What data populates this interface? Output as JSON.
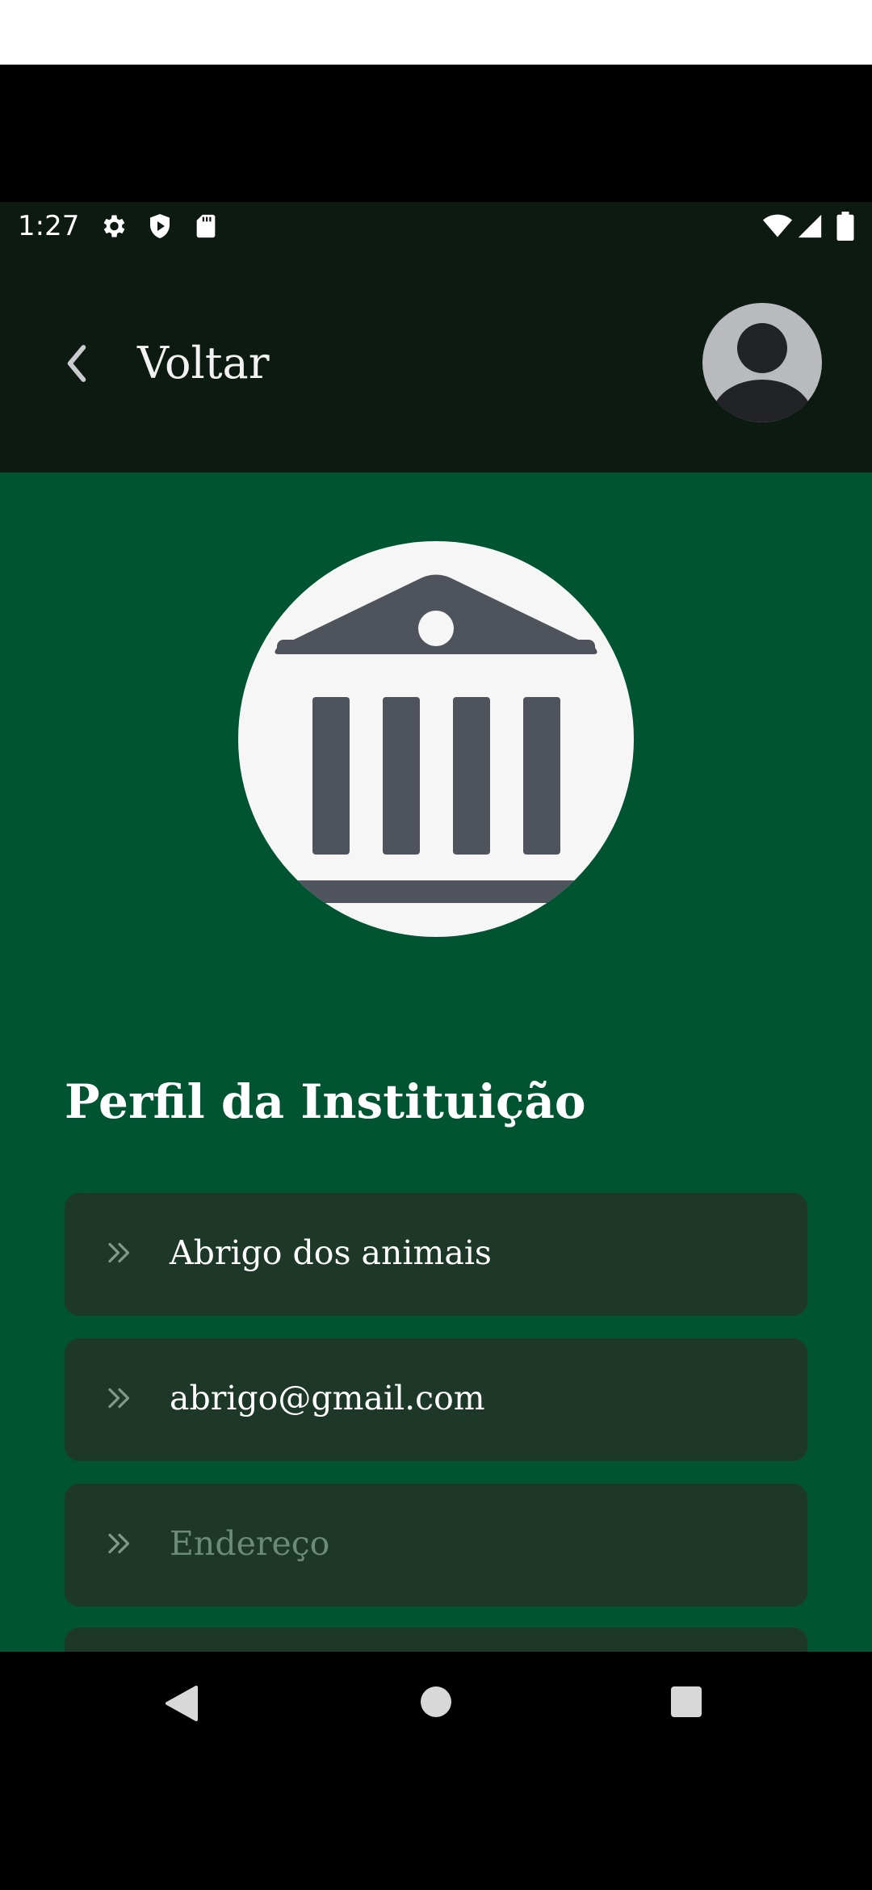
{
  "status_bar": {
    "time": "1:27",
    "left_icons": [
      "gear-icon",
      "shield-play-icon",
      "sd-card-icon"
    ],
    "right_icons": [
      "wifi-icon",
      "signal-icon",
      "battery-icon"
    ]
  },
  "app_bar": {
    "back_label": "Voltar",
    "avatar_icon": "user-avatar-icon"
  },
  "institution": {
    "icon": "institution-building-icon",
    "section_title": "Perfil da Instituição",
    "fields": [
      {
        "icon": "double-chevron-right-icon",
        "value": "Abrigo dos animais",
        "placeholder": ""
      },
      {
        "icon": "double-chevron-right-icon",
        "value": "abrigo@gmail.com",
        "placeholder": ""
      },
      {
        "icon": "double-chevron-right-icon",
        "value": "",
        "placeholder": "Endereço"
      }
    ]
  },
  "nav_bar": {
    "back": "nav-back-icon",
    "home": "nav-home-icon",
    "recents": "nav-recents-icon"
  },
  "colors": {
    "app_bar": "#0c1a12",
    "content_bg": "#005432",
    "field_bg": "#1d3828",
    "icon_gray": "#4f535c"
  }
}
